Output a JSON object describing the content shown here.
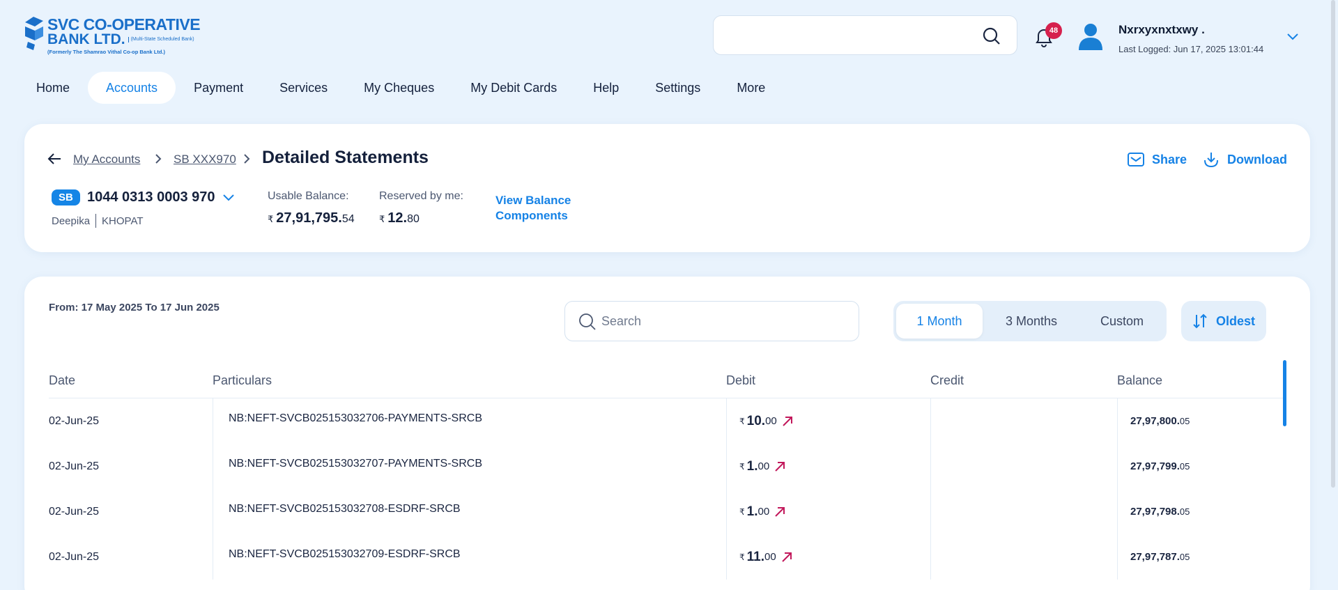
{
  "logo": {
    "line1": "SVC CO-OPERATIVE",
    "line2": "BANK LTD.",
    "tag": "(Multi-State Scheduled Bank)",
    "line3": "(Formerly The Shamrao Vithal Co-op Bank Ltd.)"
  },
  "header": {
    "search_placeholder": "",
    "notification_count": "48",
    "user_name": "Nxrxyxnxtxwy .",
    "last_logged": "Last Logged: Jun 17, 2025 13:01:44"
  },
  "nav": [
    {
      "label": "Home",
      "active": false
    },
    {
      "label": "Accounts",
      "active": true
    },
    {
      "label": "Payment",
      "active": false
    },
    {
      "label": "Services",
      "active": false
    },
    {
      "label": "My Cheques",
      "active": false
    },
    {
      "label": "My Debit Cards",
      "active": false
    },
    {
      "label": "Help",
      "active": false
    },
    {
      "label": "Settings",
      "active": false
    },
    {
      "label": "More",
      "active": false
    }
  ],
  "breadcrumb": {
    "items": [
      "My Accounts",
      "SB XXX970"
    ],
    "title": "Detailed Statements"
  },
  "actions": {
    "share": "Share",
    "download": "Download"
  },
  "account": {
    "type": "SB",
    "number": "1044 0313 0003 970",
    "holder": "Deepika",
    "branch": "KHOPAT",
    "usable_label": "Usable Balance:",
    "usable_currency": "₹",
    "usable_main": "27,91,795.",
    "usable_decimal": "54",
    "reserved_label": "Reserved by me:",
    "reserved_currency": "₹",
    "reserved_main": "12.",
    "reserved_decimal": "80",
    "view_components_l1": "View Balance",
    "view_components_l2": "Components"
  },
  "statement": {
    "date_range": "From: 17 May 2025 To 17 Jun 2025",
    "search_placeholder": "Search",
    "periods": [
      "1 Month",
      "3 Months",
      "Custom"
    ],
    "active_period": "1 Month",
    "sort_label": "Oldest",
    "columns": [
      "Date",
      "Particulars",
      "Debit",
      "Credit",
      "Balance"
    ],
    "rows": [
      {
        "date": "02-Jun-25",
        "particulars": "NB:NEFT-SVCB025153032706-PAYMENTS-SRCB",
        "debit_main": "10.",
        "debit_dec": "00",
        "credit": "",
        "balance_main": "27,97,800.",
        "balance_dec": "05"
      },
      {
        "date": "02-Jun-25",
        "particulars": "NB:NEFT-SVCB025153032707-PAYMENTS-SRCB",
        "debit_main": "1.",
        "debit_dec": "00",
        "credit": "",
        "balance_main": "27,97,799.",
        "balance_dec": "05"
      },
      {
        "date": "02-Jun-25",
        "particulars": "NB:NEFT-SVCB025153032708-ESDRF-SRCB",
        "debit_main": "1.",
        "debit_dec": "00",
        "credit": "",
        "balance_main": "27,97,798.",
        "balance_dec": "05"
      },
      {
        "date": "02-Jun-25",
        "particulars": "NB:NEFT-SVCB025153032709-ESDRF-SRCB",
        "debit_main": "11.",
        "debit_dec": "00",
        "credit": "",
        "balance_main": "27,97,787.",
        "balance_dec": "05"
      }
    ],
    "currency": "₹"
  },
  "colors": {
    "accent": "#1582e6",
    "background": "#e9f3fd",
    "badge": "#d6204d",
    "debit_arrow": "#c2185b"
  }
}
